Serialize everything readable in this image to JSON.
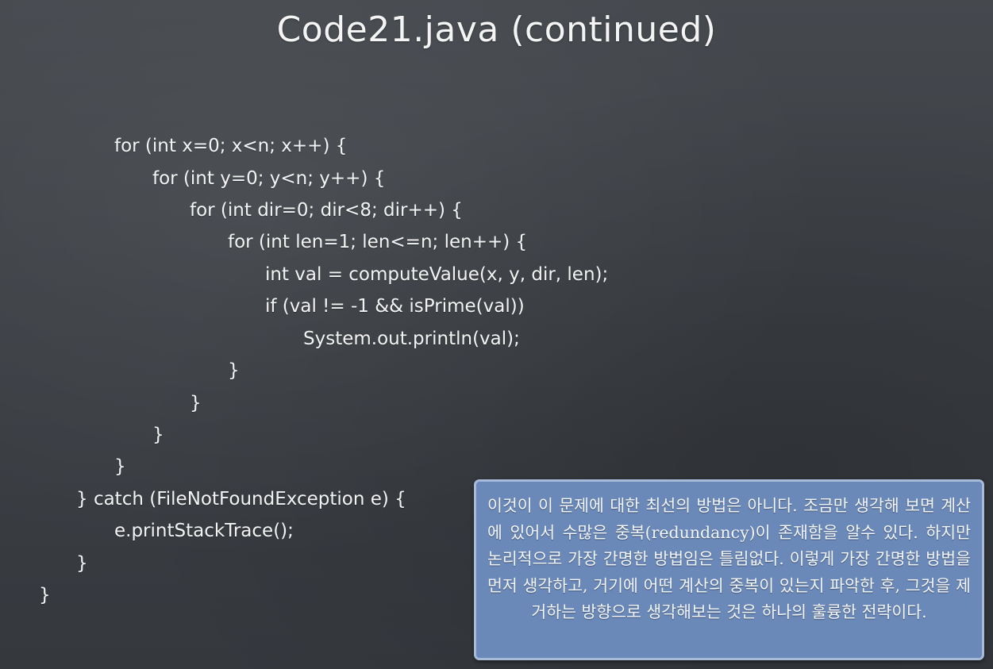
{
  "slide": {
    "title": "Code21.java (continued)",
    "code_lines": [
      "for (int x=0; x<n; x++) {",
      "for (int y=0; y<n; y++) {",
      "for (int dir=0; dir<8; dir++) {",
      "for (int len=1; len<=n; len++) {",
      "int val = computeValue(x, y, dir, len);",
      "if (val != -1 && isPrime(val))",
      "System.out.println(val);",
      "}",
      "}",
      "}",
      "}",
      "} catch (FileNotFoundException e) {",
      "e.printStackTrace();",
      "}",
      "}"
    ],
    "note": "이것이 이 문제에 대한 최선의 방법은 아니다. 조금만 생각해 보면 계산에 있어서 수많은 중복(redundancy)이 존재함을 알수 있다. 하지만 논리적으로 가장 간명한 방법임은 틀림없다. 이렇게 가장 간명한 방법을 먼저 생각하고, 거기에 어떤 계산의 중복이 있는지 파악한 후, 그것을 제거하는 방향으로 생각해보는 것은 하나의 훌륭한 전략이다.",
    "colors": {
      "background": "#3e4247",
      "note_background": "#6a88b8",
      "note_border": "#a7bbd8",
      "text": "#f3f3f3"
    }
  }
}
